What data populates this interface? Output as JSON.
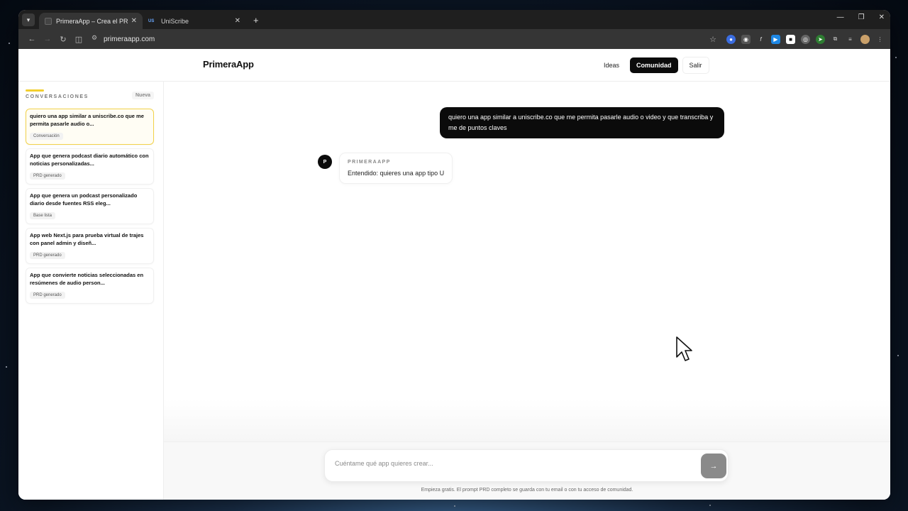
{
  "browser": {
    "tabs": [
      {
        "title": "PrimeraApp – Crea el PRD y Pr",
        "active": true
      },
      {
        "title": "UniScribe",
        "active": false,
        "favicon_text": "US"
      }
    ],
    "url": "primeraapp.com"
  },
  "header": {
    "brand": "PrimeraApp",
    "nav": {
      "ideas": "Ideas",
      "comunidad": "Comunidad",
      "salir": "Salir"
    }
  },
  "sidebar": {
    "title": "CONVERSACIONES",
    "new_label": "Nueva",
    "items": [
      {
        "title": "quiero una app similar a uniscribe.co que me permita pasarle audio o...",
        "tag": "Conversación"
      },
      {
        "title": "App que genera podcast diario automático con noticias personalizadas...",
        "tag": "PRD generado"
      },
      {
        "title": "App que genera un podcast personalizado diario desde fuentes RSS eleg...",
        "tag": "Base lista"
      },
      {
        "title": "App web Next.js para prueba virtual de trajes con panel admin y diseñ...",
        "tag": "PRD generado"
      },
      {
        "title": "App que convierte noticias seleccionadas en resúmenes de audio person...",
        "tag": "PRD generado"
      }
    ]
  },
  "chat": {
    "user_message": "quiero una app similar a uniscribe.co que me permita pasarle audio o video y que transcriba y me de puntos claves",
    "bot_avatar": "P",
    "bot_name": "PRIMERAAPP",
    "bot_message": "Entendido: quieres una app tipo U"
  },
  "composer": {
    "placeholder": "Cuéntame qué app quieres crear...",
    "send_icon": "→",
    "footnote": "Empieza gratis. El prompt PRD completo se guarda con tu email o con tu acceso de comunidad."
  },
  "colors": {
    "accent": "#f2cf2f",
    "dark": "#0b0b0b"
  }
}
